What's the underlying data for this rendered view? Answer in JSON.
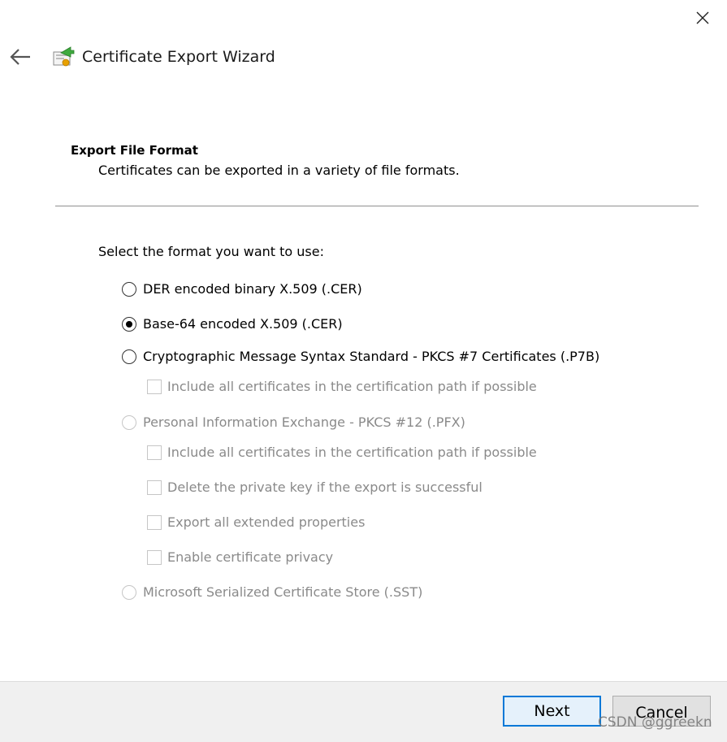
{
  "window": {
    "title": "Certificate Export Wizard",
    "close_icon": "close-icon",
    "back_icon": "back-arrow-icon",
    "wizard_icon": "certificate-export-icon"
  },
  "section": {
    "title": "Export File Format",
    "description": "Certificates can be exported in a variety of file formats."
  },
  "prompt": "Select the format you want to use:",
  "formats": [
    {
      "label": "DER encoded binary X.509 (.CER)",
      "selected": false,
      "enabled": true
    },
    {
      "label": "Base-64 encoded X.509 (.CER)",
      "selected": true,
      "enabled": true
    },
    {
      "label": "Cryptographic Message Syntax Standard - PKCS #7 Certificates (.P7B)",
      "selected": false,
      "enabled": true
    },
    {
      "label": "Personal Information Exchange - PKCS #12 (.PFX)",
      "selected": false,
      "enabled": false
    },
    {
      "label": "Microsoft Serialized Certificate Store (.SST)",
      "selected": false,
      "enabled": false
    }
  ],
  "p7b_options": [
    {
      "label": "Include all certificates in the certification path if possible",
      "checked": false,
      "enabled": false
    }
  ],
  "pfx_options": [
    {
      "label": "Include all certificates in the certification path if possible",
      "checked": false,
      "enabled": false
    },
    {
      "label": "Delete the private key if the export is successful",
      "checked": false,
      "enabled": false
    },
    {
      "label": "Export all extended properties",
      "checked": false,
      "enabled": false
    },
    {
      "label": "Enable certificate privacy",
      "checked": false,
      "enabled": false
    }
  ],
  "buttons": {
    "next": "Next",
    "cancel": "Cancel"
  },
  "watermark": "CSDN @ggreekn",
  "colors": {
    "accent": "#0078d7",
    "disabled_text": "#8a8a8a",
    "footer_bg": "#f0f0f0"
  }
}
